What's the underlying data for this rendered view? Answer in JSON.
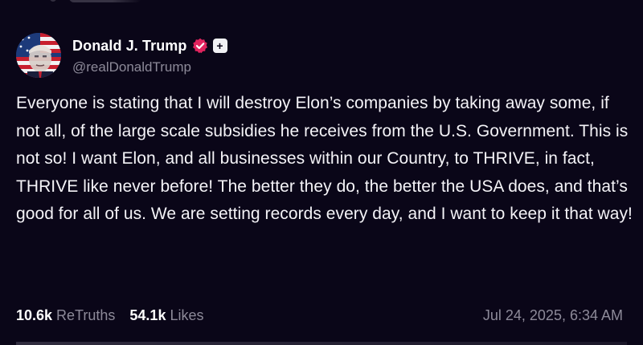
{
  "post": {
    "author": {
      "display_name": "Donald J. Trump",
      "handle": "@realDonaldTrump",
      "verified_icon": "verified-badge-icon",
      "plus_badge": "+",
      "accent_color": "#e0245e"
    },
    "text": "Everyone is stating that I will destroy Elon’s companies by taking away some, if not all, of the large scale subsidies he receives from the U.S. Government. This is not so! I want Elon, and all businesses within our Country, to THRIVE, in fact, THRIVE like never before! The better they do, the better the USA does, and that’s good for all of us. We are setting records every day, and I want to keep it that way!",
    "stats": {
      "retruths_count": "10.6k",
      "retruths_label": "ReTruths",
      "likes_count": "54.1k",
      "likes_label": "Likes"
    },
    "timestamp": "Jul 24, 2025, 6:34 AM"
  },
  "colors": {
    "background": "#0a0618",
    "text_primary": "#ffffff",
    "text_secondary": "#8d8a99"
  }
}
